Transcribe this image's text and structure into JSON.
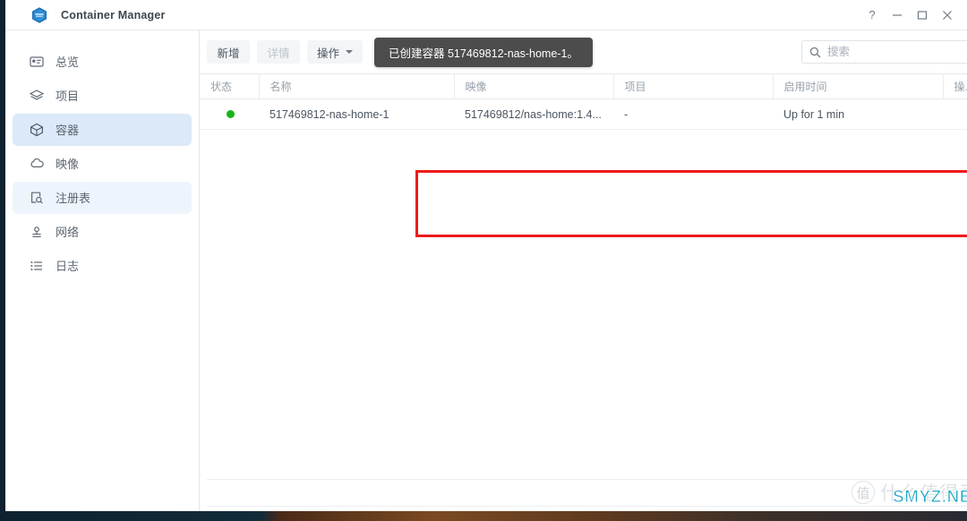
{
  "window": {
    "title": "Container Manager",
    "app_icon": "container-hexagon-icon",
    "controls": {
      "help": "?",
      "minimize": "—",
      "maximize": "□",
      "close": "×"
    }
  },
  "sidebar": {
    "items": [
      {
        "label": "总览",
        "icon": "overview-card-icon",
        "state": "normal"
      },
      {
        "label": "项目",
        "icon": "layers-icon",
        "state": "normal"
      },
      {
        "label": "容器",
        "icon": "cube-icon",
        "state": "selected"
      },
      {
        "label": "映像",
        "icon": "cloud-icon",
        "state": "normal"
      },
      {
        "label": "注册表",
        "icon": "registry-search-icon",
        "state": "hover"
      },
      {
        "label": "网络",
        "icon": "network-icon",
        "state": "normal"
      },
      {
        "label": "日志",
        "icon": "list-icon",
        "state": "normal"
      }
    ]
  },
  "toolbar": {
    "add_label": "新增",
    "details_label": "详情",
    "actions_label": "操作",
    "actions_caret": "caret-down-icon"
  },
  "search": {
    "icon": "search-icon",
    "placeholder": "搜索",
    "value": ""
  },
  "toast": {
    "message": "已创建容器 517469812-nas-home-1。"
  },
  "table": {
    "columns": [
      {
        "key": "status",
        "label": "状态"
      },
      {
        "key": "name",
        "label": "名称"
      },
      {
        "key": "image",
        "label": "映像"
      },
      {
        "key": "project",
        "label": "项目"
      },
      {
        "key": "uptime",
        "label": "启用时间"
      },
      {
        "key": "actions",
        "label": "操..."
      },
      {
        "key": "settings",
        "label": ""
      }
    ],
    "settings_icon": "column-settings-kebab-icon",
    "rows": [
      {
        "status": "running",
        "status_icon": "green-status-dot",
        "name": "517469812-nas-home-1",
        "image": "517469812/nas-home:1.4...",
        "project": "-",
        "uptime": "Up for 1 min"
      }
    ]
  },
  "annotation": {
    "highlight_color": "#ee1b1b"
  },
  "watermark": {
    "badge": "值",
    "text": "什么值得买",
    "overlay": "SMYZ.NET"
  },
  "colors": {
    "accent": "#dbe9f8",
    "status_running": "#19b419",
    "toast_bg": "#4c4c4c",
    "annotation": "#ee1b1b"
  }
}
